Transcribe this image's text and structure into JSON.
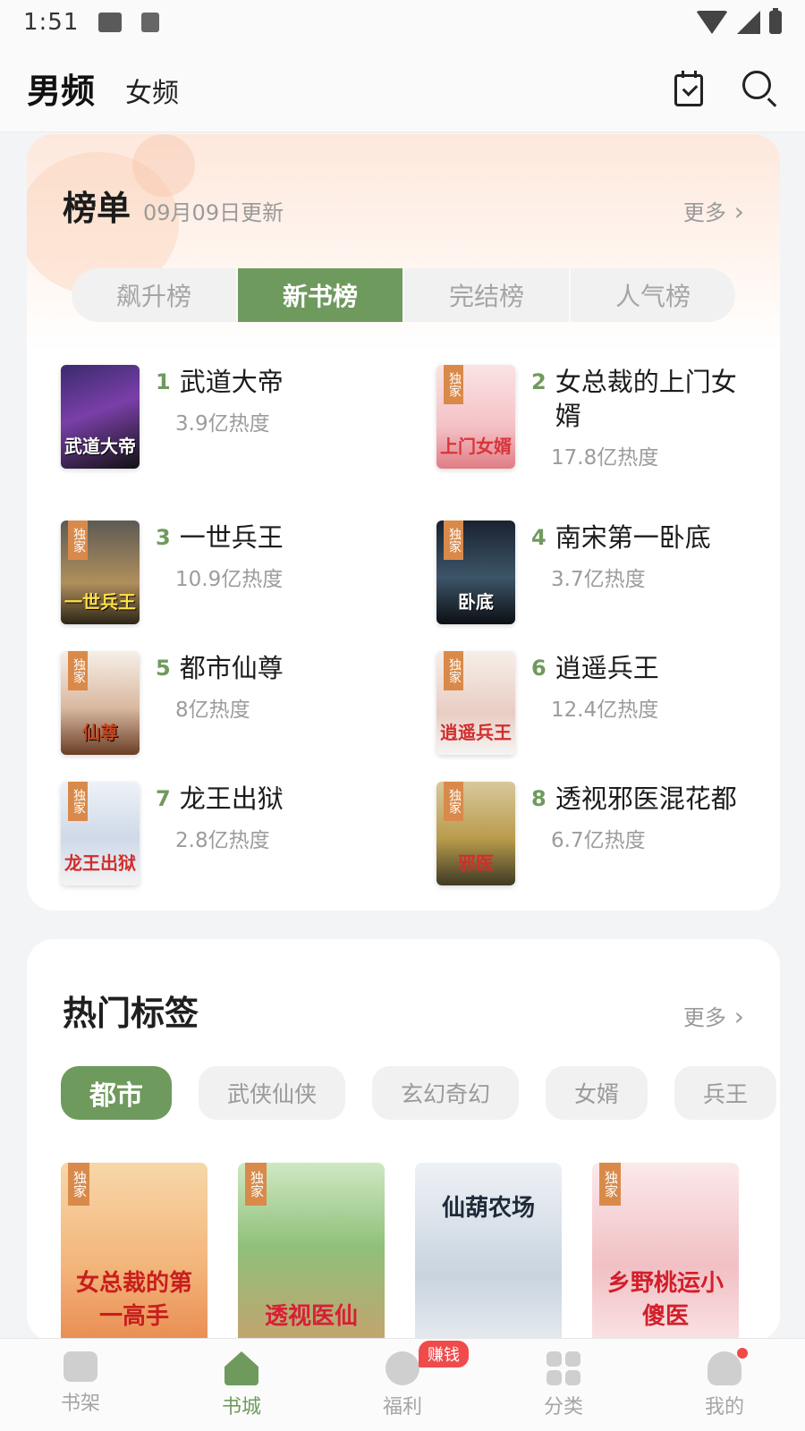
{
  "status_bar": {
    "time": "1:51"
  },
  "header": {
    "tabs": [
      {
        "label": "男频",
        "active": true
      },
      {
        "label": "女频",
        "active": false
      }
    ],
    "icons": [
      "checklist-icon",
      "search-icon"
    ]
  },
  "ranking": {
    "title": "榜单",
    "updated": "09月09日更新",
    "more": "更多",
    "segments": [
      {
        "label": "飙升榜",
        "active": false
      },
      {
        "label": "新书榜",
        "active": true
      },
      {
        "label": "完结榜",
        "active": false
      },
      {
        "label": "人气榜",
        "active": false
      }
    ],
    "books": [
      {
        "rank": "1",
        "title": "武道大帝",
        "heat": "3.9亿热度",
        "cover_text": "武道大帝",
        "exclusive": ""
      },
      {
        "rank": "2",
        "title": "女总裁的上门女婿",
        "heat": "17.8亿热度",
        "cover_text": "上门女婿",
        "exclusive": "独家"
      },
      {
        "rank": "3",
        "title": "一世兵王",
        "heat": "10.9亿热度",
        "cover_text": "一世兵王",
        "exclusive": "独家"
      },
      {
        "rank": "4",
        "title": "南宋第一卧底",
        "heat": "3.7亿热度",
        "cover_text": "卧底",
        "exclusive": "独家"
      },
      {
        "rank": "5",
        "title": "都市仙尊",
        "heat": "8亿热度",
        "cover_text": "仙尊",
        "exclusive": "独家"
      },
      {
        "rank": "6",
        "title": "逍遥兵王",
        "heat": "12.4亿热度",
        "cover_text": "逍遥兵王",
        "exclusive": "独家"
      },
      {
        "rank": "7",
        "title": "龙王出狱",
        "heat": "2.8亿热度",
        "cover_text": "龙王出狱",
        "exclusive": "独家"
      },
      {
        "rank": "8",
        "title": "透视邪医混花都",
        "heat": "6.7亿热度",
        "cover_text": "邪医",
        "exclusive": "独家"
      }
    ]
  },
  "hot_tags": {
    "title": "热门标签",
    "more": "更多",
    "chips": [
      {
        "label": "都市",
        "active": true
      },
      {
        "label": "武侠仙侠",
        "active": false
      },
      {
        "label": "玄幻奇幻",
        "active": false
      },
      {
        "label": "女婿",
        "active": false
      },
      {
        "label": "兵王",
        "active": false
      }
    ],
    "covers": [
      {
        "exclusive": "独家",
        "cover_text": "女总裁的第一高手"
      },
      {
        "exclusive": "独家",
        "cover_text": "透视医仙"
      },
      {
        "exclusive": "",
        "cover_text": "仙葫农场"
      },
      {
        "exclusive": "独家",
        "cover_text": "乡野桃运小傻医"
      }
    ]
  },
  "bottom_nav": {
    "items": [
      {
        "label": "书架",
        "icon": "bookshelf-icon"
      },
      {
        "label": "书城",
        "icon": "home-icon"
      },
      {
        "label": "福利",
        "icon": "gift-icon",
        "badge": "赚钱"
      },
      {
        "label": "分类",
        "icon": "category-grid-icon"
      },
      {
        "label": "我的",
        "icon": "profile-icon"
      }
    ]
  },
  "colors": {
    "accent": "#6f9a5e",
    "badge": "#ef4b4b",
    "muted_text": "#9a9a9a",
    "exclusive_tag": "#d98a4a"
  }
}
